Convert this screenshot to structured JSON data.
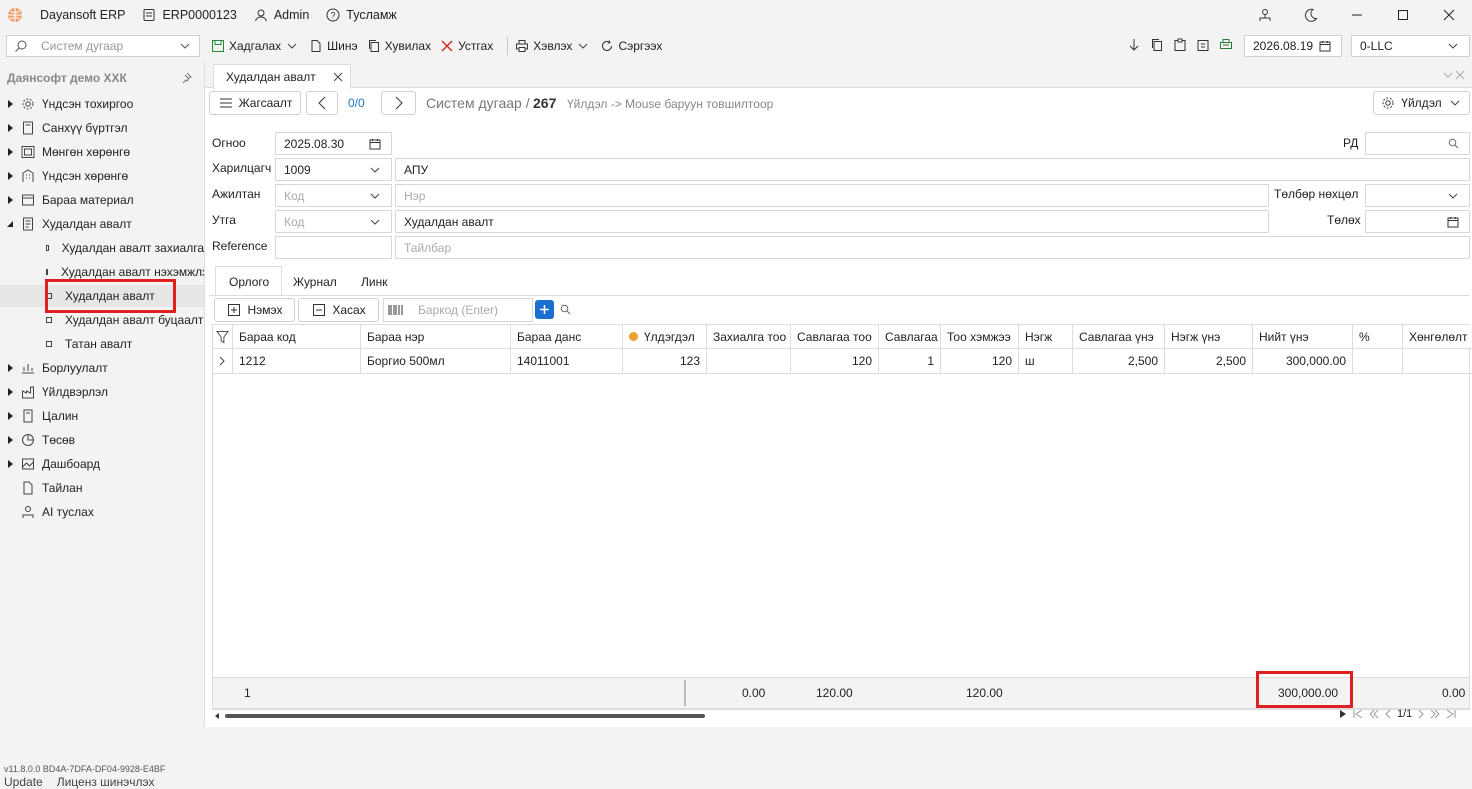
{
  "title_bar": {
    "app_name": "Dayansoft ERP",
    "db_name": "ERP0000123",
    "user": "Admin",
    "help": "Тусламж"
  },
  "toolbar": {
    "search_placeholder": "Систем дугаар",
    "save": "Хадгалах",
    "new": "Шинэ",
    "copy": "Хувилах",
    "delete": "Устгах",
    "print": "Хэвлэх",
    "refresh": "Сэргээх",
    "date": "2026.08.19",
    "company": "0-LLC"
  },
  "sidebar": {
    "org": "Даянсофт демо ХХК",
    "items": [
      {
        "label": "Үндсэн тохиргоо",
        "icon": "gear-icon"
      },
      {
        "label": "Санхүү бүртгэл",
        "icon": "ledger-icon"
      },
      {
        "label": "Мөнгөн хөрөнгө",
        "icon": "cash-icon"
      },
      {
        "label": "Үндсэн хөрөнгө",
        "icon": "building-icon"
      },
      {
        "label": "Бараа материал",
        "icon": "inventory-icon"
      },
      {
        "label": "Худалдан авалт",
        "icon": "purchase-icon"
      }
    ],
    "sub_items": [
      "Худалдан авалт захиалга",
      "Худалдан авалт нэхэмжлэ",
      "Худалдан авалт",
      "Худалдан авалт буцаалт",
      "Татан авалт"
    ],
    "items2": [
      {
        "label": "Борлуулалт",
        "icon": "sales-icon"
      },
      {
        "label": "Үйлдвэрлэл",
        "icon": "factory-icon"
      },
      {
        "label": "Цалин",
        "icon": "salary-icon"
      },
      {
        "label": "Төсөв",
        "icon": "budget-icon"
      },
      {
        "label": "Дашбоард",
        "icon": "dashboard-icon"
      },
      {
        "label": "Тайлан",
        "icon": "report-icon"
      },
      {
        "label": "AI туслах",
        "icon": "ai-icon"
      }
    ],
    "version": "v11.8.0.0   BD4A-7DFA-DF04-9928-E4BF",
    "update": "Update",
    "license": "Лиценз шинэчлэх"
  },
  "document": {
    "tab_title": "Худалдан авалт",
    "list_button": "Жагсаалт",
    "pager": "0/0",
    "sys_label": "Систем дугаар /",
    "sys_number": "267",
    "hint": "Үйлдэл -> Mouse баруун товшилтоор",
    "action_button": "Үйлдэл"
  },
  "form": {
    "date_label": "Огноо",
    "date_value": "2025.08.30",
    "partner_label": "Харилцагч",
    "partner_code": "1009",
    "partner_name": "АПУ",
    "employee_label": "Ажилтан",
    "code_placeholder": "Код",
    "name_placeholder": "Нэр",
    "purpose_label": "Утга",
    "purpose_value": "Худалдан авалт",
    "reference_label": "Reference",
    "description_placeholder": "Тайлбар",
    "rd_label": "РД",
    "payment_terms_label": "Төлбөр нөхцөл",
    "pay_label": "Төлөх"
  },
  "subtabs": [
    "Орлого",
    "Журнал",
    "Линк"
  ],
  "grid_toolbar": {
    "add": "Нэмэх",
    "remove": "Хасах",
    "barcode_placeholder": "Баркод (Enter)"
  },
  "grid": {
    "columns": [
      "Бараа код",
      "Бараа нэр",
      "Бараа данс",
      "Үлдэгдэл",
      "Захиалга тоо",
      "Савлагаа тоо",
      "Савлагаа",
      "Тоо хэмжээ",
      "Нэгж",
      "Савлагаа үнэ",
      "Нэгж үнэ",
      "Нийт үнэ",
      "%",
      "Хөнгөлөлт"
    ],
    "rows": [
      [
        "1212",
        "Боргио 500мл",
        "14011001",
        "123",
        "",
        "120",
        "1",
        "120",
        "ш",
        "2,500",
        "2,500",
        "300,000.00",
        "",
        ""
      ]
    ],
    "footer": {
      "count": "1",
      "order_qty": "0.00",
      "pack_qty": "120.00",
      "qty": "120.00",
      "total": "300,000.00",
      "discount": "0.00"
    },
    "page": "1/1"
  }
}
